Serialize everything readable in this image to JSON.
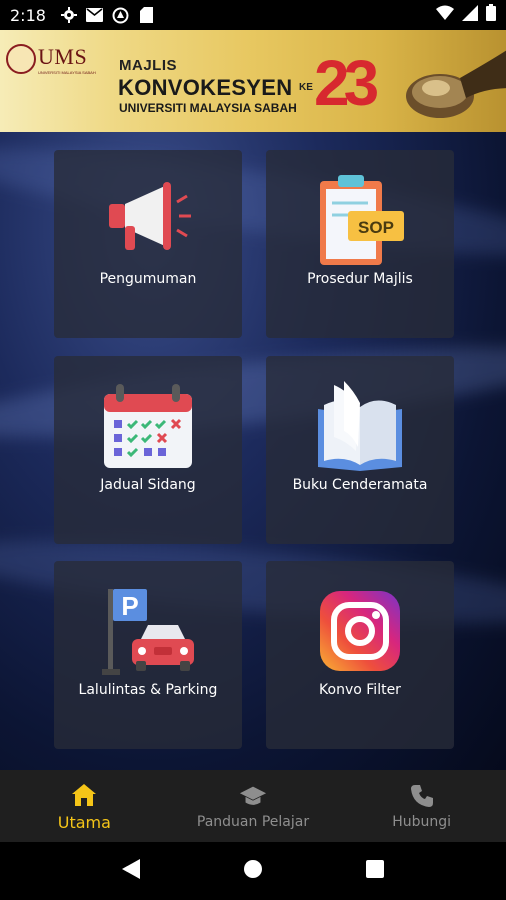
{
  "status_bar": {
    "time": "2:18",
    "icons": [
      "gear-icon",
      "mail-icon",
      "vpn-icon",
      "sd-card-icon"
    ],
    "right_icons": [
      "wifi-icon",
      "signal-icon",
      "battery-icon"
    ]
  },
  "banner": {
    "logo_text": "UMS",
    "logo_subtext": "UNIVERSITI MALAYSIA SABAH",
    "line1": "MAJLIS",
    "line2": "KONVOKESYEN",
    "line3": "UNIVERSITI MALAYSIA SABAH",
    "ke": "KE",
    "number": "23"
  },
  "tiles": [
    {
      "label": "Pengumuman",
      "icon": "megaphone-icon"
    },
    {
      "label": "Prosedur Majlis",
      "icon": "sop-clipboard-icon"
    },
    {
      "label": "Jadual Sidang",
      "icon": "calendar-icon"
    },
    {
      "label": "Buku Cenderamata",
      "icon": "book-icon"
    },
    {
      "label": "Lalulintas & Parking",
      "icon": "parking-icon"
    },
    {
      "label": "Konvo Filter",
      "icon": "instagram-icon"
    }
  ],
  "bottom_nav": {
    "items": [
      {
        "label": "Utama",
        "icon": "home-icon",
        "active": true
      },
      {
        "label": "Panduan Pelajar",
        "icon": "graduation-cap-icon",
        "active": false
      },
      {
        "label": "Hubungi",
        "icon": "phone-icon",
        "active": false
      }
    ]
  },
  "colors": {
    "accent": "#f5c518",
    "tile_bg": "#282c38",
    "nav_bg": "#1f1f1f",
    "banner_red": "#d7282f"
  }
}
